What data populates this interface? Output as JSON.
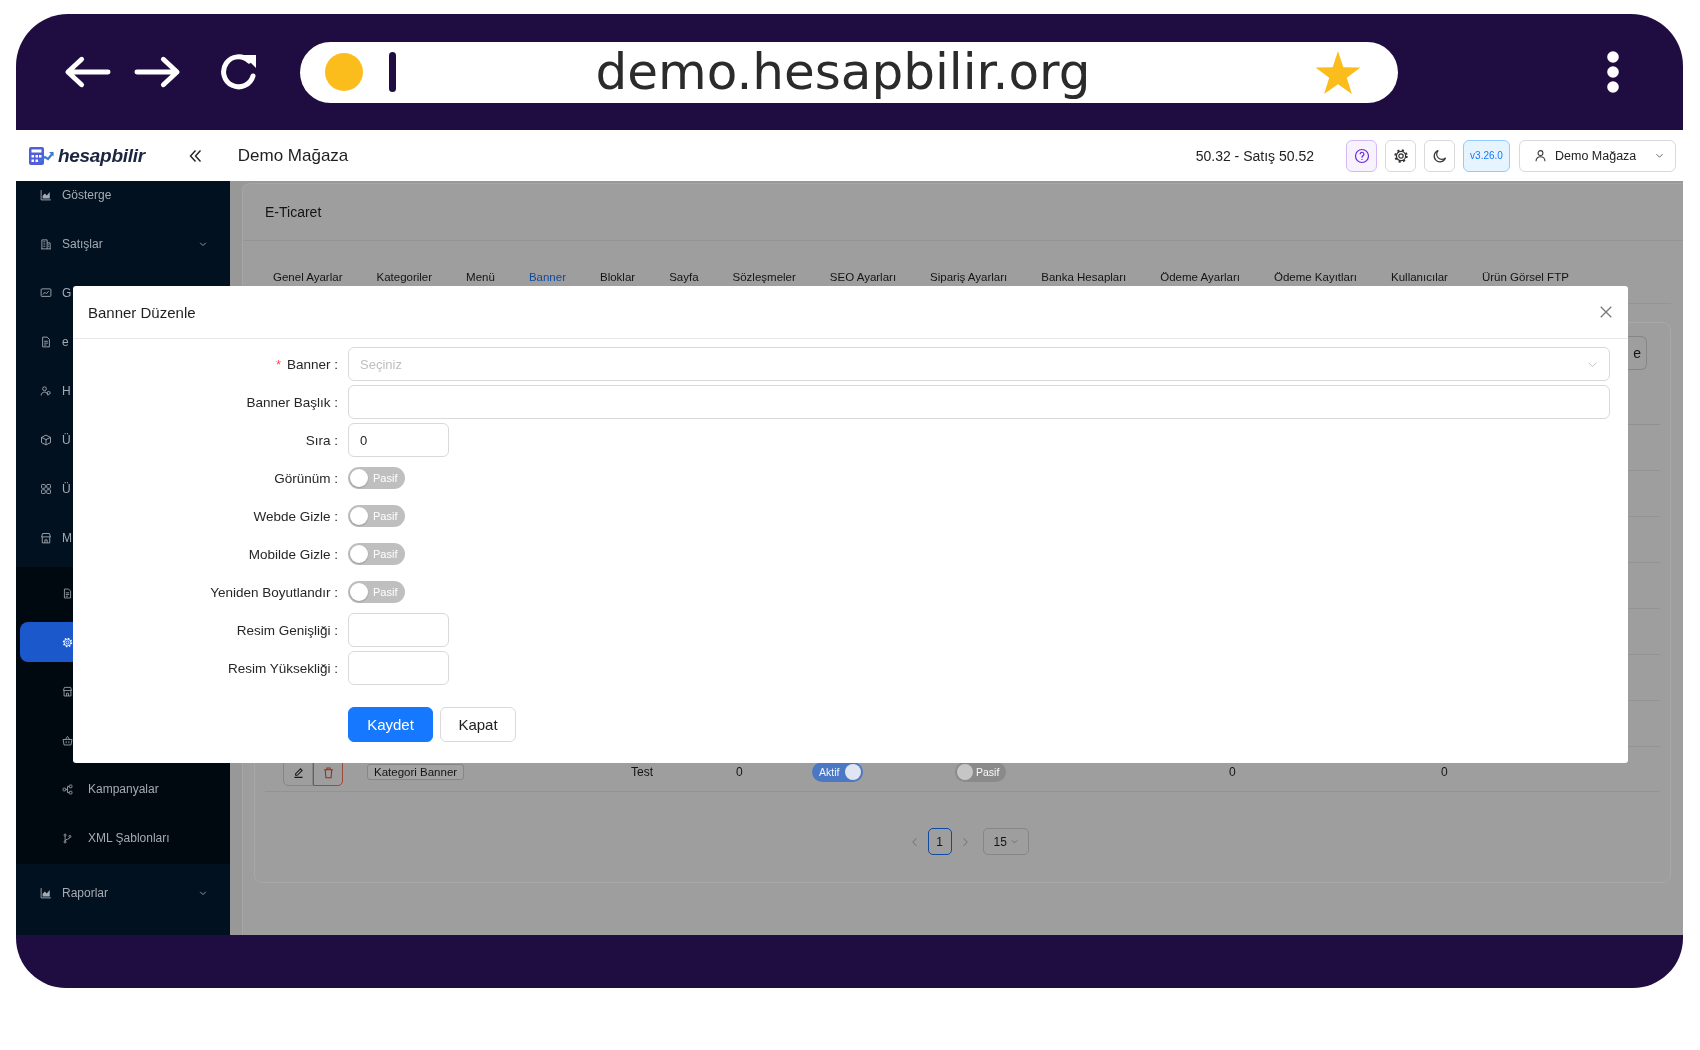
{
  "browser": {
    "url": "demo.hesapbilir.org"
  },
  "header": {
    "logo": "hesapbilir",
    "store": "Demo Mağaza",
    "rate": "50.32 - Satış 50.52",
    "version": "v3.26.0",
    "user": "Demo Mağaza"
  },
  "sidebar": {
    "items": [
      {
        "label": "Gösterge",
        "kind": "link",
        "selected": false
      },
      {
        "label": "Satışlar",
        "kind": "group",
        "expanded": false,
        "selected": false
      },
      {
        "label": "G",
        "kind": "link",
        "selected": false
      },
      {
        "label": "e",
        "kind": "link",
        "selected": false
      },
      {
        "label": "H",
        "kind": "link",
        "selected": false
      },
      {
        "label": "Ü",
        "kind": "link",
        "selected": false
      },
      {
        "label": "Ü",
        "kind": "link",
        "selected": false
      },
      {
        "label": "M",
        "kind": "group",
        "expanded": true,
        "selected": false,
        "children": [
          {
            "selected": false
          },
          {
            "selected": true
          },
          {
            "selected": false
          },
          {
            "selected": false
          },
          {
            "label": "Kampanyalar",
            "selected": false
          },
          {
            "label": "XML Şablonları",
            "selected": false
          }
        ]
      },
      {
        "label": "Raporlar",
        "kind": "group",
        "expanded": false,
        "selected": false
      }
    ]
  },
  "page": {
    "title": "E-Ticaret",
    "tabs": [
      {
        "label": "Genel Ayarlar",
        "selected": false
      },
      {
        "label": "Kategoriler",
        "selected": false
      },
      {
        "label": "Menü",
        "selected": false
      },
      {
        "label": "Banner",
        "selected": true
      },
      {
        "label": "Bloklar",
        "selected": false
      },
      {
        "label": "Sayfa",
        "selected": false
      },
      {
        "label": "Sözleşmeler",
        "selected": false
      },
      {
        "label": "SEO Ayarları",
        "selected": false
      },
      {
        "label": "Sipariş Ayarları",
        "selected": false
      },
      {
        "label": "Banka Hesapları",
        "selected": false
      },
      {
        "label": "Ödeme Ayarları",
        "selected": false
      },
      {
        "label": "Ödeme Kayıtları",
        "selected": false
      },
      {
        "label": "Kullanıcılar",
        "selected": false
      },
      {
        "label": "Ürün Görsel FTP",
        "selected": false
      }
    ]
  },
  "table": {
    "action_button": "e",
    "rows": [
      {
        "tag": "Kategori Banner",
        "column_3": "Test",
        "column_4": "0",
        "column_5": {
          "on": true,
          "label": "Aktif"
        },
        "column_6": {
          "on": false,
          "label": "Pasif"
        },
        "column_7": "0",
        "column_8": "0"
      }
    ]
  },
  "pagination": {
    "pages": [
      {
        "label": "1",
        "selected": true
      }
    ],
    "page_size": "15"
  },
  "modal": {
    "title": "Banner Düzenle",
    "fields": [
      {
        "label": "Banner :",
        "required_mark": "*",
        "kind": "select",
        "placeholder": "Seçiniz"
      },
      {
        "label": "Banner Başlık :",
        "kind": "text"
      },
      {
        "label": "Sıra :",
        "kind": "number",
        "value": "0"
      },
      {
        "label": "Görünüm :",
        "kind": "switch",
        "on": false,
        "state": "Pasif"
      },
      {
        "label": "Webde Gizle :",
        "kind": "switch",
        "on": false,
        "state": "Pasif"
      },
      {
        "label": "Mobilde Gizle :",
        "kind": "switch",
        "on": false,
        "state": "Pasif"
      },
      {
        "label": "Yeniden Boyutlandır :",
        "kind": "switch",
        "on": false,
        "state": "Pasif"
      },
      {
        "label": "Resim Genişliği :",
        "kind": "number"
      },
      {
        "label": "Resim Yüksekliği :",
        "kind": "number"
      }
    ],
    "buttons": [
      {
        "label": "Kaydet",
        "kind": "primary"
      },
      {
        "label": "Kapat",
        "kind": "default"
      }
    ]
  }
}
